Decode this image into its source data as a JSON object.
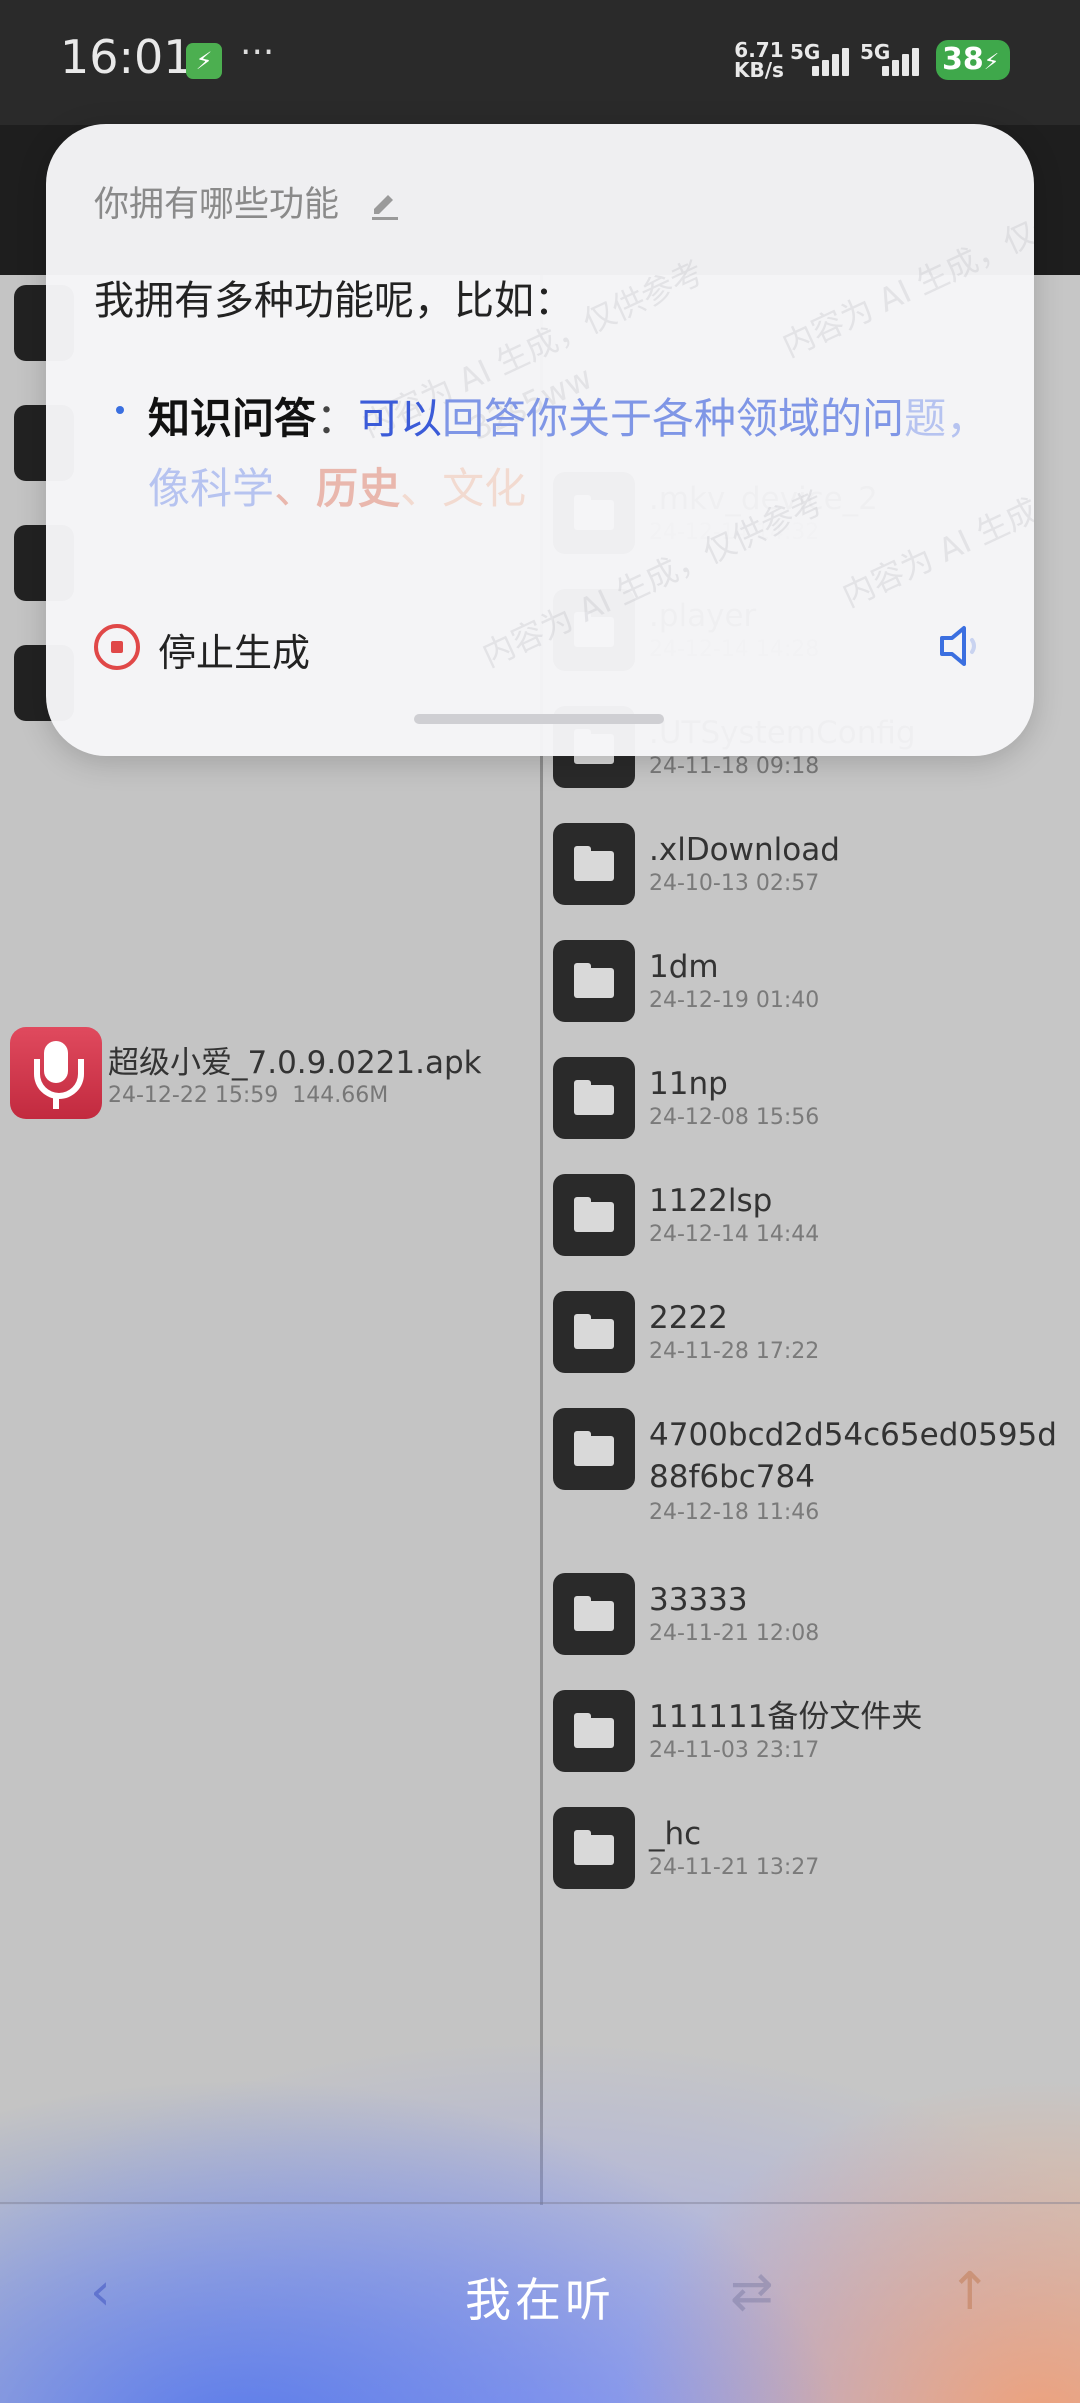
{
  "status_bar": {
    "time": "16:01",
    "charging_icon": "lightning-icon",
    "more": "···",
    "speed_value": "6.71",
    "speed_unit": "KB/s",
    "signal1": "5G",
    "signal2": "5G",
    "battery": "38"
  },
  "ai_card": {
    "question": "你拥有哪些功能",
    "answer_intro": "我拥有多种功能呢，比如：",
    "bullet_key": "知识问答",
    "bullet_colon": "：",
    "bullet_p1": "可以",
    "bullet_p2": "回答你关于各种领域的问",
    "bullet_p3": "题，像科学",
    "bullet_p4": "、",
    "bullet_p5": "历史",
    "bullet_p6": "、",
    "bullet_p7": "文化",
    "stop_label": "停止生成",
    "watermark": "内容为 AI 生成，仅供参考",
    "watermark2": "32s5ww"
  },
  "left_pane": {
    "apk": {
      "name": "超级小爱_7.0.9.0221.apk",
      "date": "24-12-22 15:59",
      "size": "144.66M"
    }
  },
  "right_pane": {
    "folders": [
      {
        "name": ".mkv_device_2",
        "date": "24-12-14 14:32"
      },
      {
        "name": ".player",
        "date": "24-12-14 14:28"
      },
      {
        "name": ".UTSystemConfig",
        "date": "24-11-18 09:18"
      },
      {
        "name": ".xlDownload",
        "date": "24-10-13 02:57"
      },
      {
        "name": "1dm",
        "date": "24-12-19 01:40"
      },
      {
        "name": "11np",
        "date": "24-12-08 15:56"
      },
      {
        "name": "1122lsp",
        "date": "24-12-14 14:44"
      },
      {
        "name": "2222",
        "date": "24-11-28 17:22"
      },
      {
        "name": "4700bcd2d54c65ed0595d88f6bc784",
        "date": "24-12-18 11:46"
      },
      {
        "name": "33333",
        "date": "24-11-21 12:08"
      },
      {
        "name": "111111备份文件夹",
        "date": "24-11-03 23:17"
      },
      {
        "name": "_hc",
        "date": "24-11-21 13:27"
      }
    ]
  },
  "bottom_bar": {
    "listen_label": "我在听",
    "back_icon": "chevron-left-icon",
    "swap_icon": "swap-icon",
    "up_icon": "arrow-up-icon"
  }
}
